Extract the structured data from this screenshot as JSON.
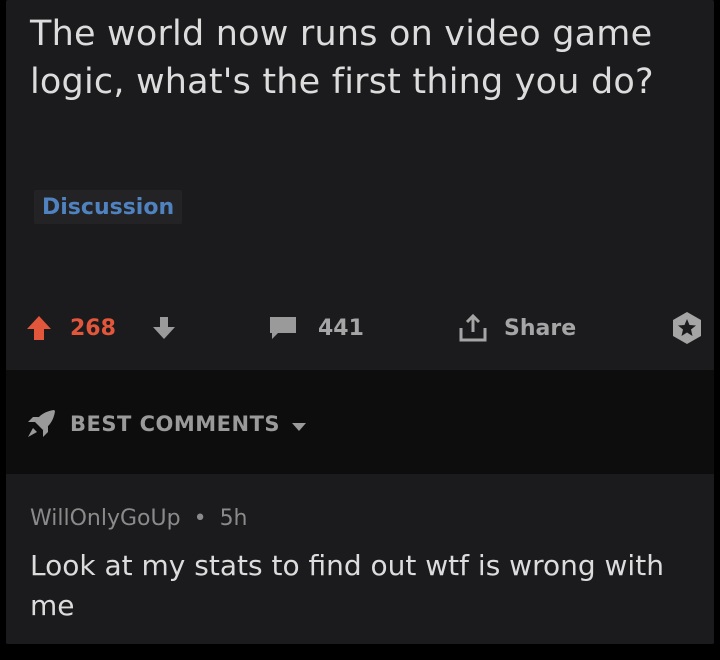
{
  "post": {
    "title": "The world now runs on video game logic, what's the first thing you do?",
    "flair": "Discussion"
  },
  "actions": {
    "upvote_count": "268",
    "comment_count": "441",
    "share_label": "Share"
  },
  "comments_header": {
    "sort_label": "BEST COMMENTS"
  },
  "comment": {
    "author": "WillOnlyGoUp",
    "separator": "•",
    "age": "5h",
    "body": "Look at my stats to find out wtf is wrong with me"
  },
  "colors": {
    "background": "#1b1b1d",
    "upvote_active": "#e2563c",
    "flair_text": "#4f82bf",
    "muted_text": "#a5a5a5"
  }
}
